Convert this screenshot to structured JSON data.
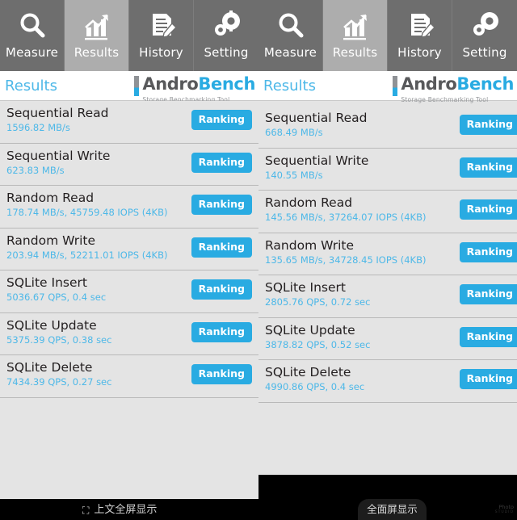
{
  "app": {
    "name": "AndroBench",
    "logo": {
      "word1": "Andro",
      "word2": "Bench",
      "subtitle": "Storage Benchmarking Tool"
    }
  },
  "tabs": [
    {
      "label": "Measure",
      "icon": "magnifier-icon",
      "active": false
    },
    {
      "label": "Results",
      "icon": "bar-chart-icon",
      "active": true
    },
    {
      "label": "History",
      "icon": "document-pencil-icon",
      "active": false
    },
    {
      "label": "Setting",
      "icon": "gears-icon",
      "active": false
    }
  ],
  "header": {
    "title": "Results"
  },
  "colors": {
    "accent": "#29abe2",
    "accent_text": "#4db8e8",
    "tab_inactive": "#6e6e6e",
    "tab_active": "#adadad",
    "panel_bg": "#e4e4e4",
    "row_text": "#231f20"
  },
  "button_label": "Ranking",
  "panels": {
    "left": {
      "rows": [
        {
          "name": "Sequential Read",
          "value": "1596.82 MB/s"
        },
        {
          "name": "Sequential Write",
          "value": "623.83 MB/s"
        },
        {
          "name": "Random Read",
          "value": "178.74 MB/s, 45759.48 IOPS (4KB)"
        },
        {
          "name": "Random Write",
          "value": "203.94 MB/s, 52211.01 IOPS (4KB)"
        },
        {
          "name": "SQLite Insert",
          "value": "5036.67 QPS, 0.4 sec"
        },
        {
          "name": "SQLite Update",
          "value": "5375.39 QPS, 0.38 sec"
        },
        {
          "name": "SQLite Delete",
          "value": "7434.39 QPS, 0.27 sec"
        }
      ]
    },
    "right": {
      "rows": [
        {
          "name": "Sequential Read",
          "value": "668.49 MB/s"
        },
        {
          "name": "Sequential Write",
          "value": "140.55 MB/s"
        },
        {
          "name": "Random Read",
          "value": "145.56 MB/s, 37264.07 IOPS (4KB)"
        },
        {
          "name": "Random Write",
          "value": "135.65 MB/s, 34728.45 IOPS (4KB)"
        },
        {
          "name": "SQLite Insert",
          "value": "2805.76 QPS, 0.72 sec"
        },
        {
          "name": "SQLite Update",
          "value": "3878.82 QPS, 0.52 sec"
        },
        {
          "name": "SQLite Delete",
          "value": "4990.86 QPS, 0.4 sec"
        }
      ]
    }
  },
  "system_bar": {
    "left_text": "上文全屏显示",
    "left_glyph": "⛶",
    "fullscreen_label": "全面屏显示",
    "watermark_line1": "Photo",
    "watermark_line2": "STUDIO"
  }
}
